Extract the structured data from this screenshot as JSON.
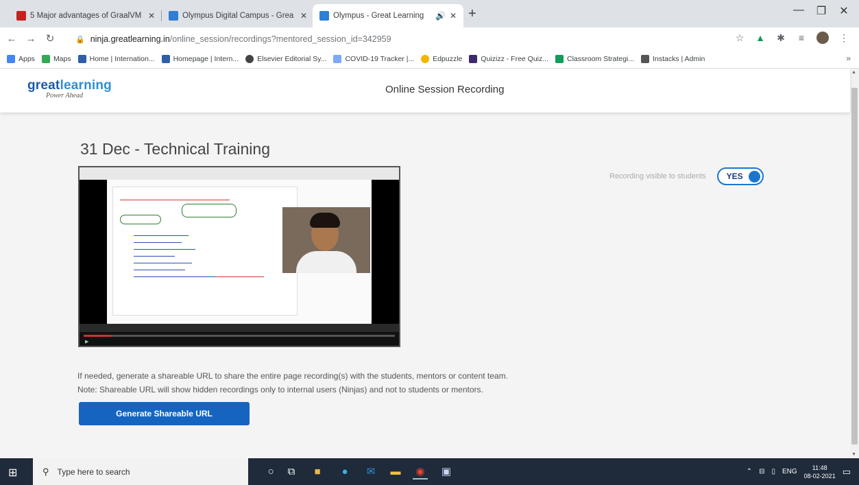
{
  "browser": {
    "tabs": [
      {
        "title": "5 Major advantages of GraalVM",
        "fav_color": "#c5221f"
      },
      {
        "title": "Olympus Digital Campus - Grea",
        "fav_color": "#2e7fd6"
      },
      {
        "title": "Olympus - Great Learning",
        "fav_color": "#2e7fd6"
      }
    ],
    "new_tab": "+",
    "url_host": "ninja.greatlearning.in",
    "url_path": "/online_session/recordings?mentored_session_id=342959",
    "bookmarks": [
      {
        "label": "Apps",
        "color": "#4285f4"
      },
      {
        "label": "Maps",
        "color": "#34a853"
      },
      {
        "label": "Home | Internation...",
        "color": "#2e5fa8"
      },
      {
        "label": "Homepage | Intern...",
        "color": "#2e5fa8"
      },
      {
        "label": "Elsevier Editorial Sy...",
        "color": "#444"
      },
      {
        "label": "COVID-19 Tracker |...",
        "color": "#7baaf7"
      },
      {
        "label": "Edpuzzle",
        "color": "#f4b400"
      },
      {
        "label": "Quizizz - Free Quiz...",
        "color": "#3c2a6b"
      },
      {
        "label": "Classroom Strategi...",
        "color": "#0f9d58"
      },
      {
        "label": "Instacks | Admin",
        "color": "#555"
      }
    ]
  },
  "header": {
    "logo_great": "great",
    "logo_learning": "learning",
    "logo_tagline": "Power Ahead",
    "title": "Online Session Recording"
  },
  "session": {
    "title": "31 Dec - Technical Training",
    "visibility_label": "Recording visible to students",
    "visibility_value": "YES",
    "visible": true
  },
  "info": {
    "line1": "If needed, generate a shareable URL to share the entire page recording(s) with the students, mentors or content team.",
    "line2": "Note: Shareable URL will show hidden recordings only to internal users (Ninjas) and not to students or mentors.",
    "button": "Generate Shareable URL"
  },
  "taskbar": {
    "search_placeholder": "Type here to search",
    "lang": "ENG",
    "time": "11:48",
    "date": "08-02-2021"
  }
}
